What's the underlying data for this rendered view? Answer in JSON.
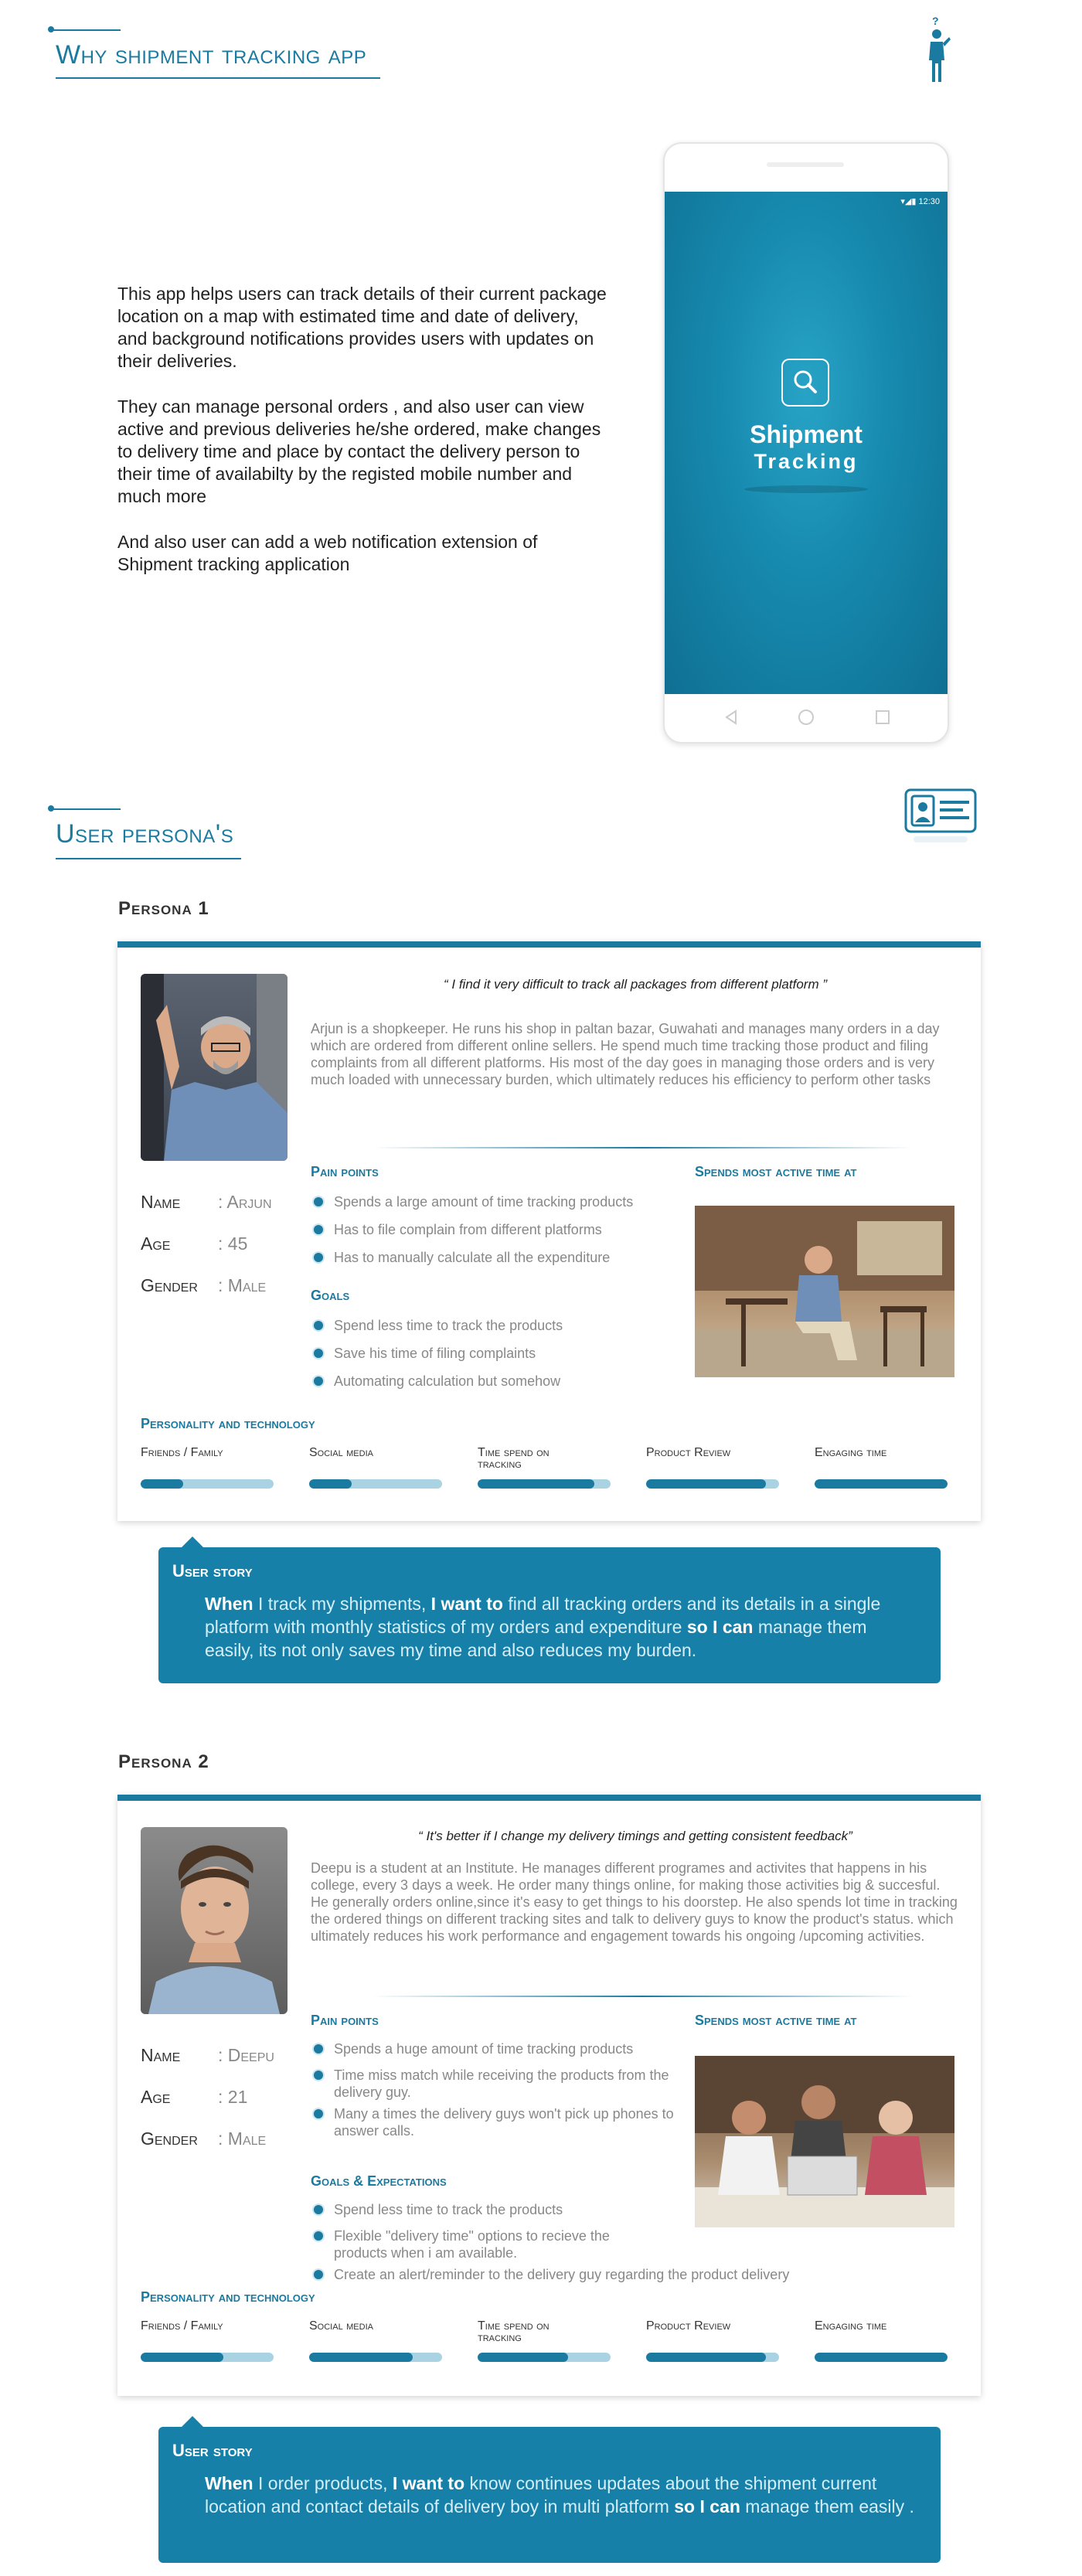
{
  "section1": {
    "title": "Why shipment tracking app"
  },
  "intro": {
    "paragraphs": [
      "This app helps users can track details of their current package location on a map with estimated time and date of delivery, and background notifications provides users with updates on their deliveries.",
      "They can manage personal orders , and also user can view active and previous deliveries he/she ordered, make changes to delivery time and place by contact the delivery person to their time of availabilty by the registed mobile number and much more",
      "And also user can add a web notification extension of Shipment tracking application"
    ]
  },
  "phone": {
    "time": "12:30",
    "app_name_line1": "Shipment",
    "app_name_line2": "Tracking",
    "icons": [
      "search-icon",
      "back-icon",
      "home-icon",
      "recent-apps-icon"
    ]
  },
  "section2": {
    "title": "User persona's"
  },
  "persona1": {
    "heading": "Persona 1",
    "quote": "“ I find it very difficult to track all packages from different platform ”",
    "description": "Arjun is a shopkeeper. He runs his shop in paltan bazar, Guwahati and manages many orders in a day which are ordered from different online sellers. He spend much time tracking those product and filing complaints from all different platforms. His most of the day goes in managing those orders and is very much loaded with unnecessary burden, which ultimately reduces his efficiency to perform other tasks",
    "name_label": "Name",
    "name_value": ": Arjun",
    "age_label": "Age",
    "age_value": ": 45",
    "gender_label": "Gender",
    "gender_value": ": Male",
    "pain_title": "Pain points",
    "pain_points": [
      "Spends a large amount of time tracking products",
      "Has to file complain from different platforms",
      "Has to manually calculate all the expenditure"
    ],
    "goals_title": "Goals",
    "goals": [
      "Spend less time to track the products",
      "Save his time of filing complaints",
      "Automating calculation but somehow"
    ],
    "active_title": "Spends most active time at",
    "pt_title": "Personality and technology",
    "pt": [
      {
        "label": "Friends / Family",
        "value": 0.32
      },
      {
        "label": "Social media",
        "value": 0.32
      },
      {
        "label": "Time spend on tracking",
        "value": 0.88
      },
      {
        "label": "Product Review",
        "value": 0.9
      },
      {
        "label": "Engaging time",
        "value": 1.0
      }
    ]
  },
  "story1": {
    "title": "User story",
    "w1": "When",
    "t1": " I track my shipments, ",
    "w2": "I want to",
    "t2": " find all tracking orders and its details in a single platform with monthly statistics of my orders and expenditure ",
    "w3": "so I can",
    "t3": " manage them easily, its not only saves my time and also reduces my burden."
  },
  "persona2": {
    "heading": "Persona 2",
    "quote": "“  It's better if I change my delivery timings and getting consistent feedback”",
    "description": "Deepu is a student at an Institute. He manages different programes and activites that happens in his college, every 3 days a week. He order many things online, for making those activities big & succesful. He generally orders online,since it's easy to get things to his doorstep. He also spends lot time in tracking the ordered things on different tracking sites and talk to delivery guys to know the product's status. which ultimately reduces his work performance and engagement towards his ongoing /upcoming activities.",
    "name_label": "Name",
    "name_value": ": Deepu",
    "age_label": "Age",
    "age_value": ": 21",
    "gender_label": "Gender",
    "gender_value": ": Male",
    "pain_title": "Pain points",
    "pain_points": [
      "Spends a huge amount of time tracking products",
      "Time miss match while receiving the products from the delivery guy.",
      "Many a times the delivery guys won't pick up phones to answer calls."
    ],
    "goals_title": "Goals & Expectations",
    "goals": [
      "Spend less time to track the products",
      "Flexible \"delivery time\" options to recieve the products when i am available.",
      "Create an alert/reminder to the delivery guy regarding the product delivery"
    ],
    "active_title": "Spends most active time at",
    "pt_title": "Personality and technology",
    "pt": [
      {
        "label": "Friends / Family",
        "value": 0.62
      },
      {
        "label": "Social media",
        "value": 0.78
      },
      {
        "label": "Time spend on tracking",
        "value": 0.68
      },
      {
        "label": "Product Review",
        "value": 0.9
      },
      {
        "label": "Engaging time",
        "value": 1.0
      }
    ]
  },
  "story2": {
    "title": "User story",
    "w1": "When",
    "t1": " I order products, ",
    "w2": "I want to",
    "t2": " know continues updates about the shipment current location and contact details of delivery boy in multi platform ",
    "w3": "so I can",
    "t3": " manage them easily ."
  },
  "colors": {
    "accent": "#1b7aa0",
    "story_bg": "#1680a8",
    "bar_track": "#a9d3e2"
  }
}
